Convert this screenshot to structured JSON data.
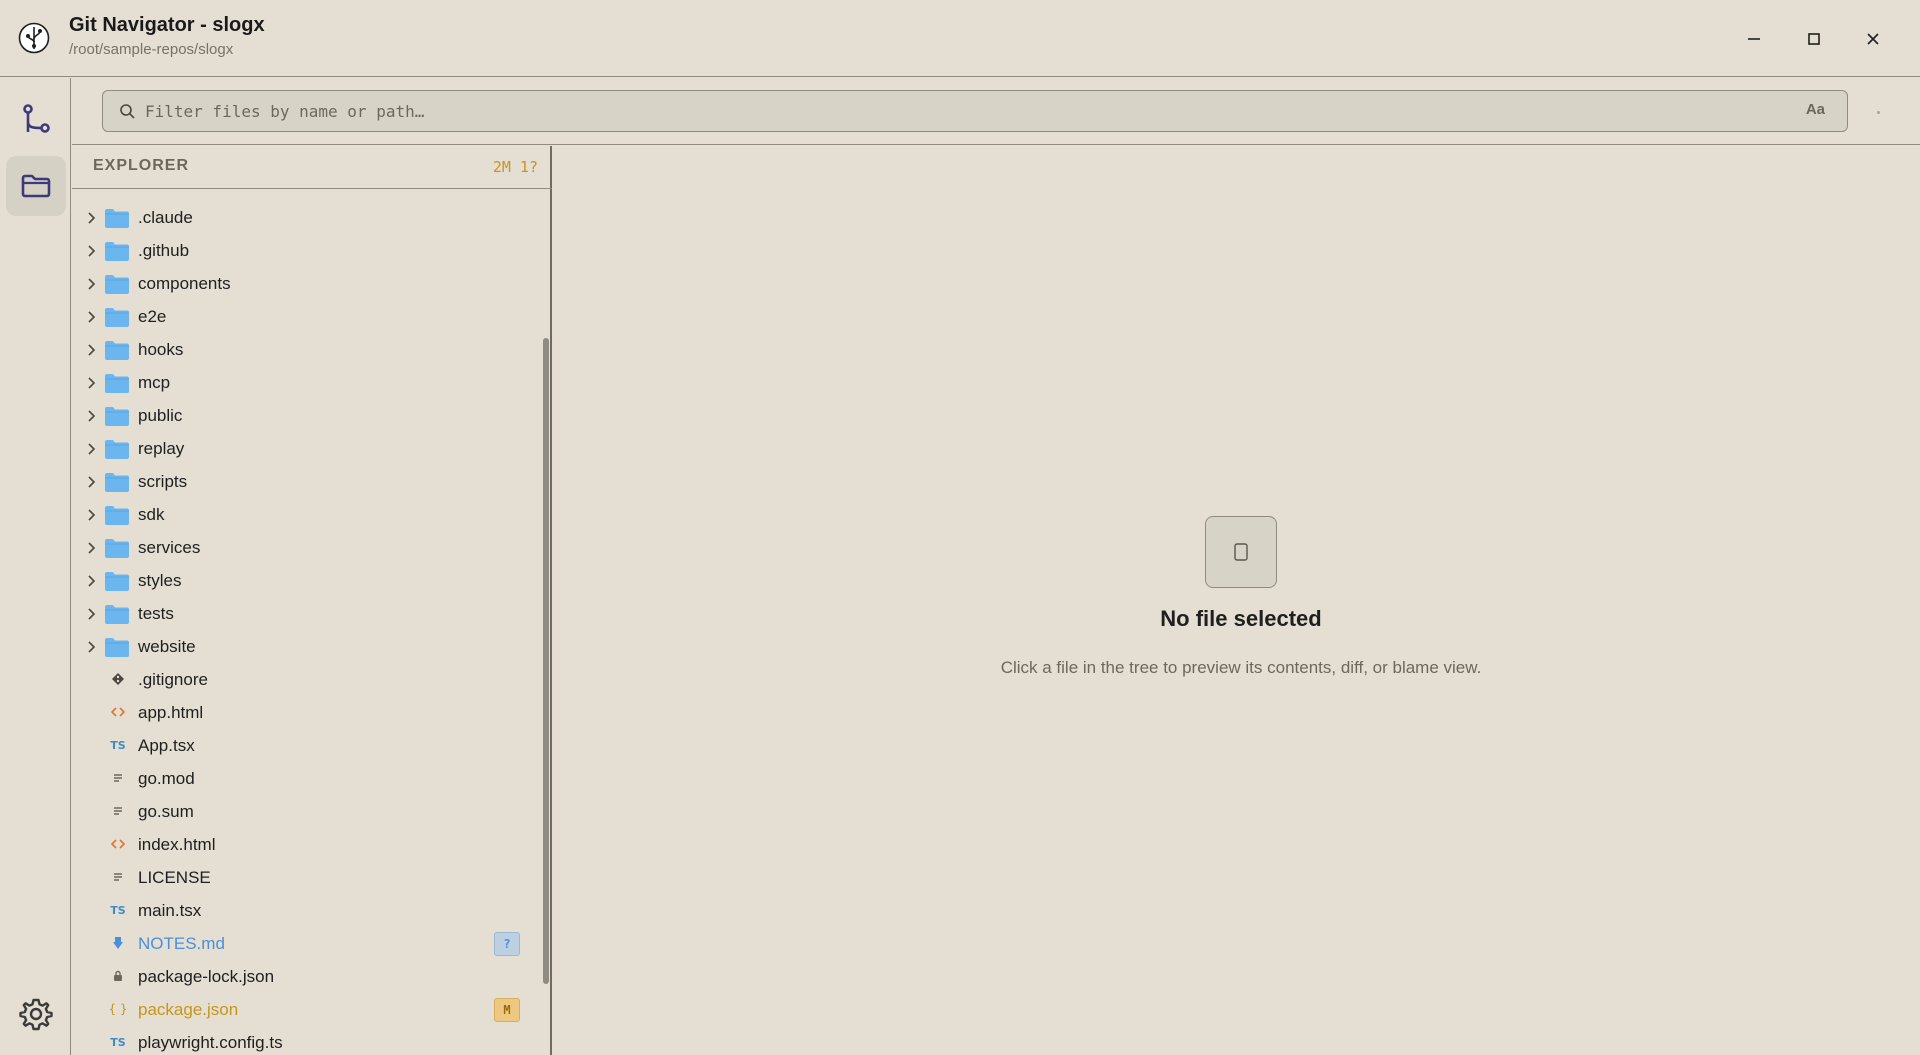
{
  "window": {
    "title": "Git Navigator - slogx",
    "path": "/root/sample-repos/slogx"
  },
  "activity": {
    "items": [
      "git-graph",
      "files",
      "settings"
    ],
    "active": "files"
  },
  "filter": {
    "placeholder": "Filter files by name or path…",
    "value": "",
    "case_toggle": "Aa"
  },
  "explorer": {
    "title": "EXPLORER",
    "status": "2M 1?",
    "folders": [
      ".claude",
      ".github",
      "components",
      "e2e",
      "hooks",
      "mcp",
      "public",
      "replay",
      "scripts",
      "sdk",
      "services",
      "styles",
      "tests",
      "website"
    ],
    "files": [
      {
        "name": ".gitignore",
        "icon": "git-icon",
        "status": ""
      },
      {
        "name": "app.html",
        "icon": "html-icon",
        "status": ""
      },
      {
        "name": "App.tsx",
        "icon": "ts-icon",
        "status": ""
      },
      {
        "name": "go.mod",
        "icon": "text-lines-icon",
        "status": ""
      },
      {
        "name": "go.sum",
        "icon": "text-lines-icon",
        "status": ""
      },
      {
        "name": "index.html",
        "icon": "html-icon",
        "status": ""
      },
      {
        "name": "LICENSE",
        "icon": "text-lines-icon",
        "status": ""
      },
      {
        "name": "main.tsx",
        "icon": "ts-icon",
        "status": ""
      },
      {
        "name": "NOTES.md",
        "icon": "markdown-icon",
        "status": "?"
      },
      {
        "name": "package-lock.json",
        "icon": "lock-icon",
        "status": ""
      },
      {
        "name": "package.json",
        "icon": "json-icon",
        "status": "M"
      },
      {
        "name": "playwright.config.ts",
        "icon": "ts-icon",
        "status": ""
      }
    ]
  },
  "preview": {
    "empty_title": "No file selected",
    "empty_subtitle": "Click a file in the tree to preview its contents, diff, or blame view."
  },
  "colors": {
    "background": "#e4dfd2",
    "border": "#8f8b80",
    "folder": "#6cb6f0",
    "modified": "#c8951c",
    "untracked": "#4a8fdc",
    "accent": "#3d3a7a"
  }
}
